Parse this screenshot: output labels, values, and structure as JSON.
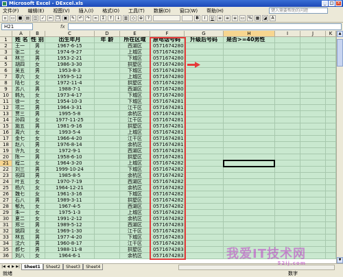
{
  "window": {
    "title": "Microsoft Excel - DExcel.xls",
    "buttons": [
      "_",
      "□",
      "×"
    ]
  },
  "menu": [
    "文件(F)",
    "编辑(E)",
    "视图(V)",
    "插入(I)",
    "格式(O)",
    "工具(T)",
    "数据(D)",
    "窗口(W)",
    "帮助(H)"
  ],
  "help_placeholder": "键入需要帮助的问题",
  "formula": {
    "namebox": "H21",
    "fx": "fx",
    "value": ""
  },
  "columns": [
    "A",
    "B",
    "C",
    "D",
    "E",
    "F",
    "G",
    "H",
    "I",
    "J",
    "K"
  ],
  "header_row": {
    "row": "1",
    "cells": [
      "姓 名",
      "性 别",
      "出生年月",
      "年 龄",
      "所在区域",
      "原电话号码",
      "升级后号码",
      "是否>=40男性",
      "",
      "",
      ""
    ]
  },
  "rows": [
    {
      "row": "2",
      "cells": [
        "王一",
        "男",
        "1967-6-15",
        "",
        "西湖区",
        "05716742801",
        "",
        "",
        "",
        "",
        ""
      ]
    },
    {
      "row": "3",
      "cells": [
        "张二",
        "女",
        "1974-9-27",
        "",
        "上城区",
        "05716742802",
        "",
        "",
        "",
        "",
        ""
      ]
    },
    {
      "row": "4",
      "cells": [
        "林三",
        "男",
        "1953-2-21",
        "",
        "下城区",
        "05716742803",
        "",
        "",
        "",
        "",
        ""
      ]
    },
    {
      "row": "5",
      "cells": [
        "胡四",
        "女",
        "1986-3-30",
        "",
        "拱墅区",
        "05716742804",
        "",
        "",
        "",
        "",
        ""
      ]
    },
    {
      "row": "6",
      "cells": [
        "吴五",
        "男",
        "1953-8-3",
        "",
        "下城区",
        "05716742805",
        "",
        "",
        "",
        "",
        ""
      ]
    },
    {
      "row": "7",
      "cells": [
        "章六",
        "女",
        "1959-5-12",
        "",
        "上城区",
        "05716742806",
        "",
        "",
        "",
        "",
        ""
      ]
    },
    {
      "row": "8",
      "cells": [
        "陆七",
        "女",
        "1972-11-4",
        "",
        "拱墅区",
        "05716742807",
        "",
        "",
        "",
        "",
        ""
      ]
    },
    {
      "row": "9",
      "cells": [
        "苏八",
        "男",
        "1988-7-1",
        "",
        "西湖区",
        "05716742808",
        "",
        "",
        "",
        "",
        ""
      ]
    },
    {
      "row": "10",
      "cells": [
        "韩九",
        "女",
        "1973-4-17",
        "",
        "下城区",
        "05716742809",
        "",
        "",
        "",
        "",
        ""
      ]
    },
    {
      "row": "11",
      "cells": [
        "徐一",
        "女",
        "1954-10-3",
        "",
        "下城区",
        "05716742810",
        "",
        "",
        "",
        "",
        ""
      ]
    },
    {
      "row": "12",
      "cells": [
        "项二",
        "男",
        "1964-3-31",
        "",
        "江干区",
        "05716742811",
        "",
        "",
        "",
        "",
        ""
      ]
    },
    {
      "row": "13",
      "cells": [
        "贾三",
        "男",
        "1995-5-8",
        "",
        "余杭区",
        "05716742812",
        "",
        "",
        "",
        "",
        ""
      ]
    },
    {
      "row": "14",
      "cells": [
        "孙四",
        "女",
        "1977-11-25",
        "",
        "江干区",
        "05716742813",
        "",
        "",
        "",
        "",
        ""
      ]
    },
    {
      "row": "15",
      "cells": [
        "施五",
        "男",
        "1981-9-16",
        "",
        "拱墅区",
        "05716742814",
        "",
        "",
        "",
        "",
        ""
      ]
    },
    {
      "row": "16",
      "cells": [
        "周六",
        "女",
        "1993-5-4",
        "",
        "上城区",
        "05716742815",
        "",
        "",
        "",
        "",
        ""
      ]
    },
    {
      "row": "17",
      "cells": [
        "金七",
        "女",
        "1966-4-20",
        "",
        "江干区",
        "05716742816",
        "",
        "",
        "",
        "",
        ""
      ]
    },
    {
      "row": "18",
      "cells": [
        "赵八",
        "男",
        "1976-8-14",
        "",
        "余杭区",
        "05716742817",
        "",
        "",
        "",
        "",
        ""
      ]
    },
    {
      "row": "19",
      "cells": [
        "许九",
        "女",
        "1972-9-1",
        "",
        "西湖区",
        "05716742818",
        "",
        "",
        "",
        "",
        ""
      ]
    },
    {
      "row": "20",
      "cells": [
        "陈一",
        "男",
        "1958-6-10",
        "",
        "拱墅区",
        "05716742819",
        "",
        "",
        "",
        "",
        ""
      ]
    },
    {
      "row": "21",
      "cells": [
        "程二",
        "女",
        "1964-3-20",
        "",
        "上城区",
        "05716742820",
        "",
        "",
        "",
        "",
        ""
      ]
    },
    {
      "row": "22",
      "cells": [
        "刘三",
        "男",
        "1999-10-24",
        "",
        "下城区",
        "05716742821",
        "",
        "",
        "",
        "",
        ""
      ]
    },
    {
      "row": "23",
      "cells": [
        "祝四",
        "男",
        "1985-8-5",
        "",
        "余杭区",
        "05716742822",
        "",
        "",
        "",
        "",
        ""
      ]
    },
    {
      "row": "24",
      "cells": [
        "叶五",
        "女",
        "1970-7-19",
        "",
        "西湖区",
        "05716742823",
        "",
        "",
        "",
        "",
        ""
      ]
    },
    {
      "row": "25",
      "cells": [
        "杨六",
        "女",
        "1964-12-21",
        "",
        "余杭区",
        "05716742824",
        "",
        "",
        "",
        "",
        ""
      ]
    },
    {
      "row": "26",
      "cells": [
        "魏七",
        "女",
        "1961-3-16",
        "",
        "下城区",
        "05716742825",
        "",
        "",
        "",
        "",
        ""
      ]
    },
    {
      "row": "27",
      "cells": [
        "石八",
        "男",
        "1989-3-11",
        "",
        "拱墅区",
        "05716742826",
        "",
        "",
        "",
        "",
        ""
      ]
    },
    {
      "row": "28",
      "cells": [
        "郁九",
        "女",
        "1967-4-5",
        "",
        "西湖区",
        "05716742827",
        "",
        "",
        "",
        "",
        ""
      ]
    },
    {
      "row": "29",
      "cells": [
        "朱一",
        "女",
        "1975-1-3",
        "",
        "上城区",
        "05716742828",
        "",
        "",
        "",
        "",
        ""
      ]
    },
    {
      "row": "30",
      "cells": [
        "夏二",
        "女",
        "1991-2-12",
        "",
        "余杭区",
        "05716742829",
        "",
        "",
        "",
        "",
        ""
      ]
    },
    {
      "row": "31",
      "cells": [
        "郑三",
        "男",
        "1989-5-12",
        "",
        "西湖区",
        "05716742830",
        "",
        "",
        "",
        "",
        ""
      ]
    },
    {
      "row": "32",
      "cells": [
        "姚四",
        "女",
        "1969-1-30",
        "",
        "江干区",
        "05716742831",
        "",
        "",
        "",
        "",
        ""
      ]
    },
    {
      "row": "33",
      "cells": [
        "林五",
        "男",
        "1977-4-20",
        "",
        "下城区",
        "05716742832",
        "",
        "",
        "",
        "",
        ""
      ]
    },
    {
      "row": "34",
      "cells": [
        "沈六",
        "男",
        "1960-8-17",
        "",
        "江干区",
        "05716742833",
        "",
        "",
        "",
        "",
        ""
      ]
    },
    {
      "row": "35",
      "cells": [
        "郝七",
        "男",
        "1988-11-8",
        "",
        "拱墅区",
        "05716742834",
        "",
        "",
        "",
        "",
        ""
      ]
    },
    {
      "row": "36",
      "cells": [
        "刘八",
        "女",
        "1964-6-1",
        "",
        "余杭区",
        "05716742835",
        "",
        "",
        "",
        "",
        ""
      ]
    }
  ],
  "sheet_tabs": [
    "Sheet1",
    "Sheet2",
    "Sheet3",
    "Sheet4"
  ],
  "active_sheet": "Sheet1",
  "status": {
    "left": "就绪",
    "right": "数字"
  },
  "watermark": {
    "main": "我爱IT技术网",
    "sub": "52ij.com"
  },
  "colors": {
    "cell_bg": "#c9e8cf",
    "highlight": "#e53b3b",
    "arrow": "#e53b3b"
  }
}
